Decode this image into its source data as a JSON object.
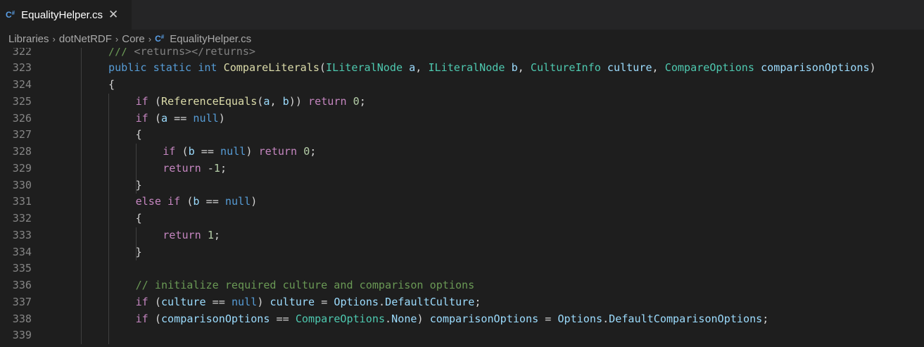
{
  "tab": {
    "icon": "csharp-file-icon",
    "label": "EqualityHelper.cs",
    "close_glyph": "✕"
  },
  "breadcrumb": {
    "items": [
      "Libraries",
      "dotNetRDF",
      "Core"
    ],
    "file": "EqualityHelper.cs",
    "separator": "›"
  },
  "editor": {
    "lines": [
      {
        "num": "322",
        "indent": 0,
        "tokens": [
          [
            "c",
            "/// "
          ],
          [
            "x",
            "<returns></returns>"
          ]
        ]
      },
      {
        "num": "323",
        "indent": 0,
        "tokens": [
          [
            "b",
            "public"
          ],
          [
            "p",
            " "
          ],
          [
            "b",
            "static"
          ],
          [
            "p",
            " "
          ],
          [
            "b",
            "int"
          ],
          [
            "p",
            " "
          ],
          [
            "f",
            "CompareLiterals"
          ],
          [
            "p",
            "("
          ],
          [
            "t",
            "ILiteralNode"
          ],
          [
            "p",
            " "
          ],
          [
            "v",
            "a"
          ],
          [
            "p",
            ", "
          ],
          [
            "t",
            "ILiteralNode"
          ],
          [
            "p",
            " "
          ],
          [
            "v",
            "b"
          ],
          [
            "p",
            ", "
          ],
          [
            "t",
            "CultureInfo"
          ],
          [
            "p",
            " "
          ],
          [
            "v",
            "culture"
          ],
          [
            "p",
            ", "
          ],
          [
            "t",
            "CompareOptions"
          ],
          [
            "p",
            " "
          ],
          [
            "v",
            "comparisonOptions"
          ],
          [
            "p",
            ")"
          ]
        ]
      },
      {
        "num": "324",
        "indent": 0,
        "tokens": [
          [
            "p",
            "{"
          ]
        ]
      },
      {
        "num": "325",
        "indent": 1,
        "tokens": [
          [
            "k",
            "if"
          ],
          [
            "p",
            " ("
          ],
          [
            "f",
            "ReferenceEquals"
          ],
          [
            "p",
            "("
          ],
          [
            "v",
            "a"
          ],
          [
            "p",
            ", "
          ],
          [
            "v",
            "b"
          ],
          [
            "p",
            ")) "
          ],
          [
            "k",
            "return"
          ],
          [
            "p",
            " "
          ],
          [
            "n",
            "0"
          ],
          [
            "p",
            ";"
          ]
        ]
      },
      {
        "num": "326",
        "indent": 1,
        "tokens": [
          [
            "k",
            "if"
          ],
          [
            "p",
            " ("
          ],
          [
            "v",
            "a"
          ],
          [
            "p",
            " == "
          ],
          [
            "b",
            "null"
          ],
          [
            "p",
            ")"
          ]
        ]
      },
      {
        "num": "327",
        "indent": 1,
        "tokens": [
          [
            "p",
            "{"
          ]
        ]
      },
      {
        "num": "328",
        "indent": 2,
        "tokens": [
          [
            "k",
            "if"
          ],
          [
            "p",
            " ("
          ],
          [
            "v",
            "b"
          ],
          [
            "p",
            " == "
          ],
          [
            "b",
            "null"
          ],
          [
            "p",
            ") "
          ],
          [
            "k",
            "return"
          ],
          [
            "p",
            " "
          ],
          [
            "n",
            "0"
          ],
          [
            "p",
            ";"
          ]
        ]
      },
      {
        "num": "329",
        "indent": 2,
        "tokens": [
          [
            "k",
            "return"
          ],
          [
            "p",
            " -"
          ],
          [
            "n",
            "1"
          ],
          [
            "p",
            ";"
          ]
        ]
      },
      {
        "num": "330",
        "indent": 1,
        "tokens": [
          [
            "p",
            "}"
          ]
        ]
      },
      {
        "num": "331",
        "indent": 1,
        "tokens": [
          [
            "k",
            "else"
          ],
          [
            "p",
            " "
          ],
          [
            "k",
            "if"
          ],
          [
            "p",
            " ("
          ],
          [
            "v",
            "b"
          ],
          [
            "p",
            " == "
          ],
          [
            "b",
            "null"
          ],
          [
            "p",
            ")"
          ]
        ]
      },
      {
        "num": "332",
        "indent": 1,
        "tokens": [
          [
            "p",
            "{"
          ]
        ]
      },
      {
        "num": "333",
        "indent": 2,
        "tokens": [
          [
            "k",
            "return"
          ],
          [
            "p",
            " "
          ],
          [
            "n",
            "1"
          ],
          [
            "p",
            ";"
          ]
        ]
      },
      {
        "num": "334",
        "indent": 1,
        "tokens": [
          [
            "p",
            "}"
          ]
        ]
      },
      {
        "num": "335",
        "indent": 1,
        "tokens": []
      },
      {
        "num": "336",
        "indent": 1,
        "tokens": [
          [
            "c",
            "// initialize required culture and comparison options"
          ]
        ]
      },
      {
        "num": "337",
        "indent": 1,
        "tokens": [
          [
            "k",
            "if"
          ],
          [
            "p",
            " ("
          ],
          [
            "v",
            "culture"
          ],
          [
            "p",
            " == "
          ],
          [
            "b",
            "null"
          ],
          [
            "p",
            ") "
          ],
          [
            "v",
            "culture"
          ],
          [
            "p",
            " = "
          ],
          [
            "v",
            "Options"
          ],
          [
            "p",
            "."
          ],
          [
            "v",
            "DefaultCulture"
          ],
          [
            "p",
            ";"
          ]
        ]
      },
      {
        "num": "338",
        "indent": 1,
        "tokens": [
          [
            "k",
            "if"
          ],
          [
            "p",
            " ("
          ],
          [
            "v",
            "comparisonOptions"
          ],
          [
            "p",
            " == "
          ],
          [
            "t",
            "CompareOptions"
          ],
          [
            "p",
            "."
          ],
          [
            "v",
            "None"
          ],
          [
            "p",
            ") "
          ],
          [
            "v",
            "comparisonOptions"
          ],
          [
            "p",
            " = "
          ],
          [
            "v",
            "Options"
          ],
          [
            "p",
            "."
          ],
          [
            "v",
            "DefaultComparisonOptions"
          ],
          [
            "p",
            ";"
          ]
        ]
      },
      {
        "num": "339",
        "indent": 1,
        "tokens": []
      }
    ]
  }
}
